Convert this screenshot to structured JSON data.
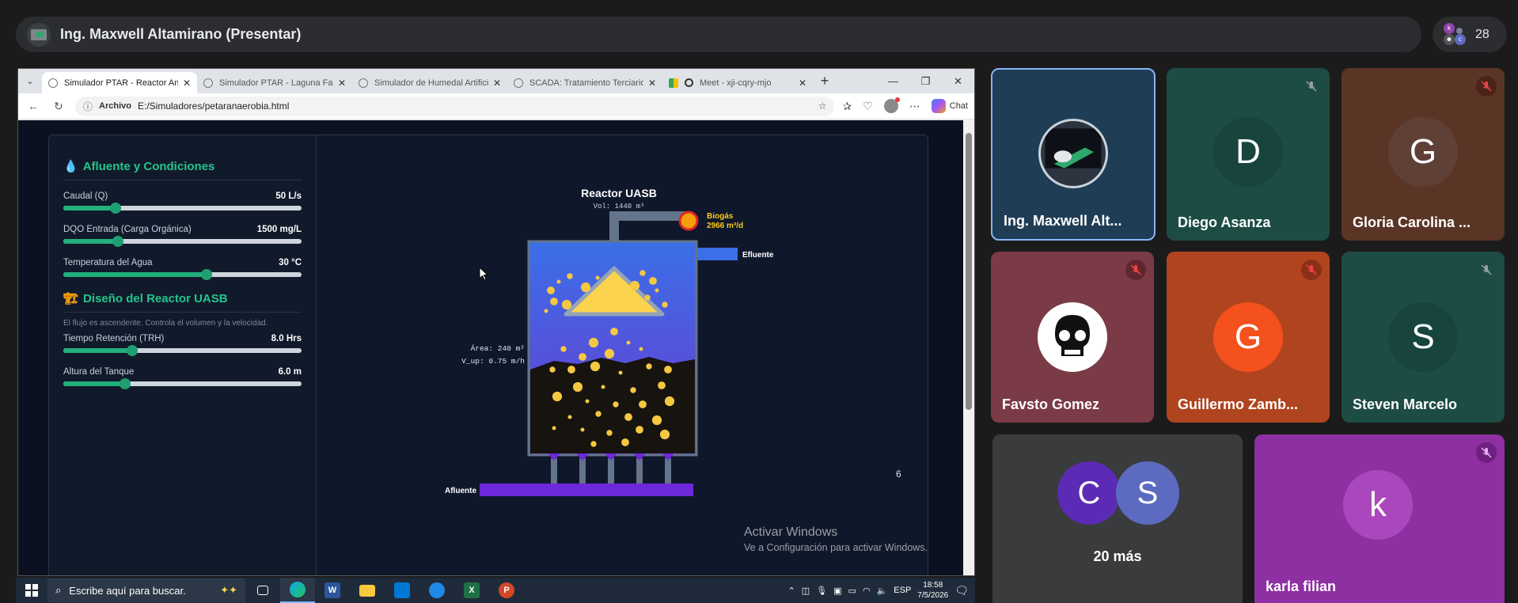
{
  "meet": {
    "presenter_title": "Ing. Maxwell Altamirano (Presentar)",
    "participant_count": "28",
    "people_avatars": [
      "k",
      "c"
    ]
  },
  "browser": {
    "tabs": [
      {
        "label": "Simulador PTAR - Reactor Anaerobio",
        "active": true
      },
      {
        "label": "Simulador PTAR - Laguna Facultativa",
        "active": false
      },
      {
        "label": "Simulador de Humedal Artificial",
        "active": false
      },
      {
        "label": "SCADA: Tratamiento Terciario (A",
        "active": false
      },
      {
        "label": "Meet - xji-cqry-mjo",
        "active": false
      }
    ],
    "address_label": "Archivo",
    "address": "E:/Simuladores/petaranaerobia.html",
    "chat_label": "Chat"
  },
  "sim": {
    "section1_title": "Afluente y Condiciones",
    "section2_title": "Diseño del Reactor UASB",
    "section2_desc": "El flujo es ascendente. Controla el volumen y la velocidad.",
    "sliders_1": [
      {
        "label": "Caudal (Q)",
        "value": "50 L/s",
        "fraction": 0.22
      },
      {
        "label": "DQO Entrada (Carga Orgánica)",
        "value": "1500 mg/L",
        "fraction": 0.23
      },
      {
        "label": "Temperatura del Agua",
        "value": "30 °C",
        "fraction": 0.6
      }
    ],
    "sliders_2": [
      {
        "label": "Tiempo Retención (TRH)",
        "value": "8.0 Hrs",
        "fraction": 0.29
      },
      {
        "label": "Altura del Tanque",
        "value": "6.0 m",
        "fraction": 0.26
      }
    ],
    "reactor_title": "Reactor UASB",
    "reactor_vol": "Vol: 1440 m³",
    "biogas_label": "Biogás",
    "biogas_value": "2966 m³/d",
    "efluente_label": "Efluente",
    "afluente_label": "Afluente",
    "area_label": "Área: 240 m²",
    "vup_label": "V_up: 0.75 m/h",
    "side_number": "6",
    "colors": {
      "accent": "#22c58b",
      "liquid_top": "#3b6fe8",
      "liquid_bottom": "#6a3ad0",
      "bubbles": "#f5c842",
      "hood": "#fcd34d"
    }
  },
  "watermark": {
    "line1": "Activar Windows",
    "line2": "Ve a Configuración para activar Windows."
  },
  "taskbar": {
    "search_placeholder": "Escribe aquí para buscar.",
    "lang": "ESP",
    "time": "18:58",
    "date": "7/5/2026"
  },
  "participants": [
    {
      "name": "Ing. Maxwell Alt...",
      "muted": false,
      "bg": "#1f3d55"
    },
    {
      "name": "Diego Asanza",
      "initial": "D",
      "muted": true,
      "bg": "#1d4c44",
      "avatar": "#17453e"
    },
    {
      "name": "Gloria Carolina ...",
      "initial": "G",
      "muted": true,
      "bg": "#5a3525",
      "avatar": "#5e4037"
    },
    {
      "name": "Favsto Gomez",
      "muted": true,
      "bg": "#7a3b46"
    },
    {
      "name": "Guillermo Zamb...",
      "initial": "G",
      "muted": true,
      "bg": "#b0441f",
      "avatar": "#f4511e"
    },
    {
      "name": "Steven Marcelo",
      "initial": "S",
      "muted": true,
      "bg": "#1d4c44",
      "avatar": "#17453e"
    },
    {
      "more_label": "20 más",
      "initials": [
        "C",
        "S"
      ],
      "bg": "#3a3b3d"
    },
    {
      "name": "karla filian",
      "initial": "k",
      "muted": true,
      "bg": "#8e2fa2",
      "avatar": "#ab47bc"
    }
  ]
}
